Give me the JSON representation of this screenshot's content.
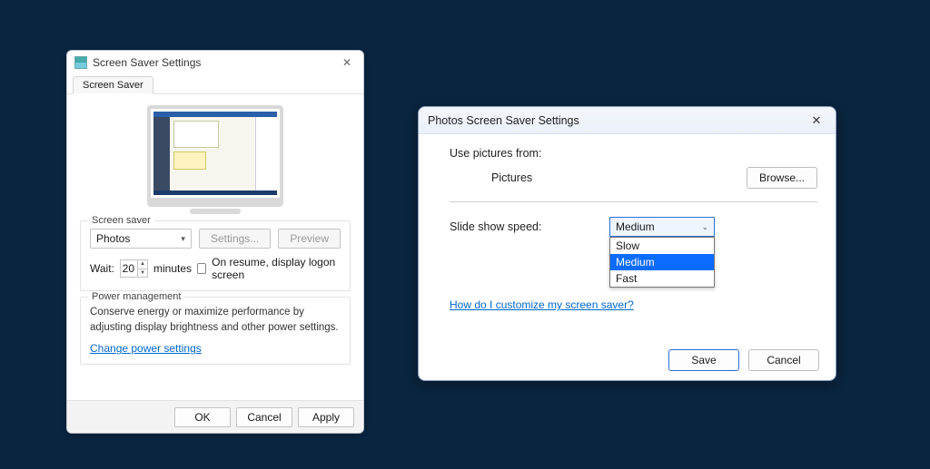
{
  "dlg1": {
    "title": "Screen Saver Settings",
    "tab": "Screen Saver",
    "saver_group_legend": "Screen saver",
    "saver_value": "Photos",
    "settings_btn": "Settings...",
    "preview_btn": "Preview",
    "wait_label": "Wait:",
    "wait_value": "20",
    "wait_unit": "minutes",
    "resume_label": "On resume, display logon screen",
    "power_group_legend": "Power management",
    "power_text": "Conserve energy or maximize performance by adjusting display brightness and other power settings.",
    "power_link": "Change power settings",
    "ok": "OK",
    "cancel": "Cancel",
    "apply": "Apply"
  },
  "dlg2": {
    "title": "Photos Screen Saver Settings",
    "pictures_from": "Use pictures from:",
    "pictures_value": "Pictures",
    "browse_btn": "Browse...",
    "speed_label": "Slide show speed:",
    "speed_value": "Medium",
    "speed_options": {
      "slow": "Slow",
      "medium": "Medium",
      "fast": "Fast"
    },
    "help_link": "How do I customize my screen saver?",
    "save": "Save",
    "cancel": "Cancel"
  }
}
